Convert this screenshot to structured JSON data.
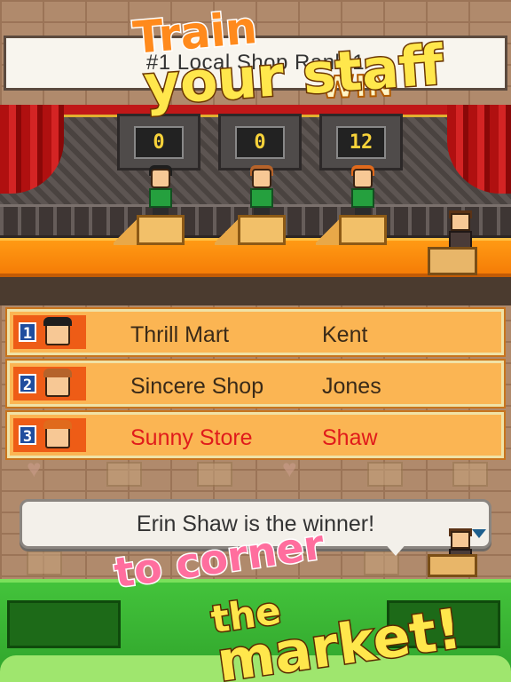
{
  "header": {
    "banner_text": "#1 Local Shop         Rank 1"
  },
  "stage": {
    "scores": [
      "0",
      "0",
      "12"
    ],
    "win_label": "WIN"
  },
  "ranking": [
    {
      "rank": "1",
      "store": "Thrill Mart",
      "person": "Kent",
      "hair_color": "#1e1e1e",
      "is_winner": false
    },
    {
      "rank": "2",
      "store": "Sincere Shop",
      "person": "Jones",
      "hair_color": "#b5632a",
      "is_winner": false
    },
    {
      "rank": "3",
      "store": "Sunny Store",
      "person": "Shaw",
      "hair_color": "#e06a1c",
      "is_winner": true
    }
  ],
  "dialog": {
    "message": "Erin Shaw is the winner!"
  },
  "promo": {
    "line1": "Train",
    "line2": "your staff",
    "line3": "to corner",
    "line4": "the",
    "line5": "market!"
  },
  "colors": {
    "winner_text": "#e01b1b",
    "row_bg": "#fbb553",
    "bottom_green": "#43c33b"
  }
}
